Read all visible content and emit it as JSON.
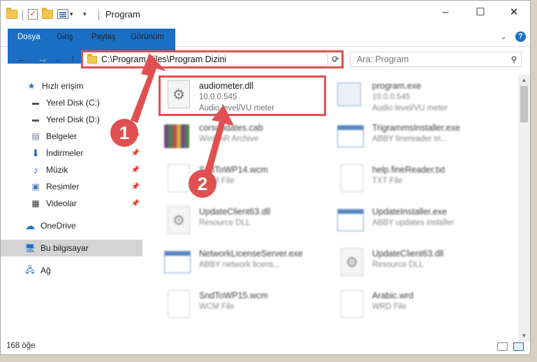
{
  "window": {
    "title": "Program",
    "controls": {
      "minimize": "–",
      "maximize": "☐",
      "close": "✕"
    }
  },
  "ribbon": {
    "tabs": [
      "Dosya",
      "Giriş",
      "Paylaş",
      "Görünüm"
    ]
  },
  "address": {
    "path": "C:\\Program Files\\Program Dizini"
  },
  "search": {
    "placeholder": "Ara: Program"
  },
  "sidebar": {
    "items": [
      {
        "label": "Hızlı erişim",
        "icon": "star-icon"
      },
      {
        "label": "Yerel Disk (C:)",
        "icon": "drive-icon"
      },
      {
        "label": "Yerel Disk (D:)",
        "icon": "drive-icon"
      },
      {
        "label": "Belgeler",
        "icon": "documents-icon"
      },
      {
        "label": "İndirmeler",
        "icon": "download-icon"
      },
      {
        "label": "Müzik",
        "icon": "music-icon"
      },
      {
        "label": "Resimler",
        "icon": "pictures-icon"
      },
      {
        "label": "Videolar",
        "icon": "video-icon"
      },
      {
        "label": "OneDrive",
        "icon": "cloud-icon"
      },
      {
        "label": "Bu bilgisayar",
        "icon": "computer-icon"
      },
      {
        "label": "Ağ",
        "icon": "network-icon"
      }
    ]
  },
  "files": [
    {
      "name": "audiometer.dll",
      "line2": "10.0.0.545",
      "line3": "Audio level/VU meter",
      "icon": "dll-gear-icon"
    },
    {
      "name": "program.exe",
      "line2": "10.0.0.545",
      "line3": "Audio level/VU meter",
      "icon": "program-exe-icon"
    },
    {
      "name": "corsupdates.cab",
      "line2": "WinRAR Archive",
      "line3": "",
      "icon": "winrar-archive-icon"
    },
    {
      "name": "TrigrammsInstaller.exe",
      "line2": "ABBY finereader tri...",
      "line3": "",
      "icon": "exe-window-icon"
    },
    {
      "name": "SndToWP14.wcm",
      "line2": "WCM File",
      "line3": "",
      "icon": "blank-file-icon"
    },
    {
      "name": "help.fineReader.txt",
      "line2": "TXT File",
      "line3": "",
      "icon": "text-file-icon"
    },
    {
      "name": "UpdateClient63.dll",
      "line2": "Resource DLL",
      "line3": "",
      "icon": "dll-gear-icon"
    },
    {
      "name": "UpdateInstaller.exe",
      "line2": "ABBY updates installer",
      "line3": "",
      "icon": "exe-window-icon"
    },
    {
      "name": "NetworkLicenseServer.exe",
      "line2": "ABBY network licens...",
      "line3": "",
      "icon": "exe-window-icon"
    },
    {
      "name": "UpdateClient63.dll",
      "line2": "Resource DLL",
      "line3": "",
      "icon": "dll-gear-icon"
    },
    {
      "name": "SndToWP15.wcm",
      "line2": "WCM File",
      "line3": "",
      "icon": "blank-file-icon"
    },
    {
      "name": "Arabic.wrd",
      "line2": "WRD File",
      "line3": "",
      "icon": "blank-file-icon"
    }
  ],
  "status": {
    "count": "168 öğe"
  },
  "callouts": [
    "1",
    "2"
  ],
  "colors": {
    "accent": "#1a6fc4",
    "annotation": "#e05050"
  }
}
